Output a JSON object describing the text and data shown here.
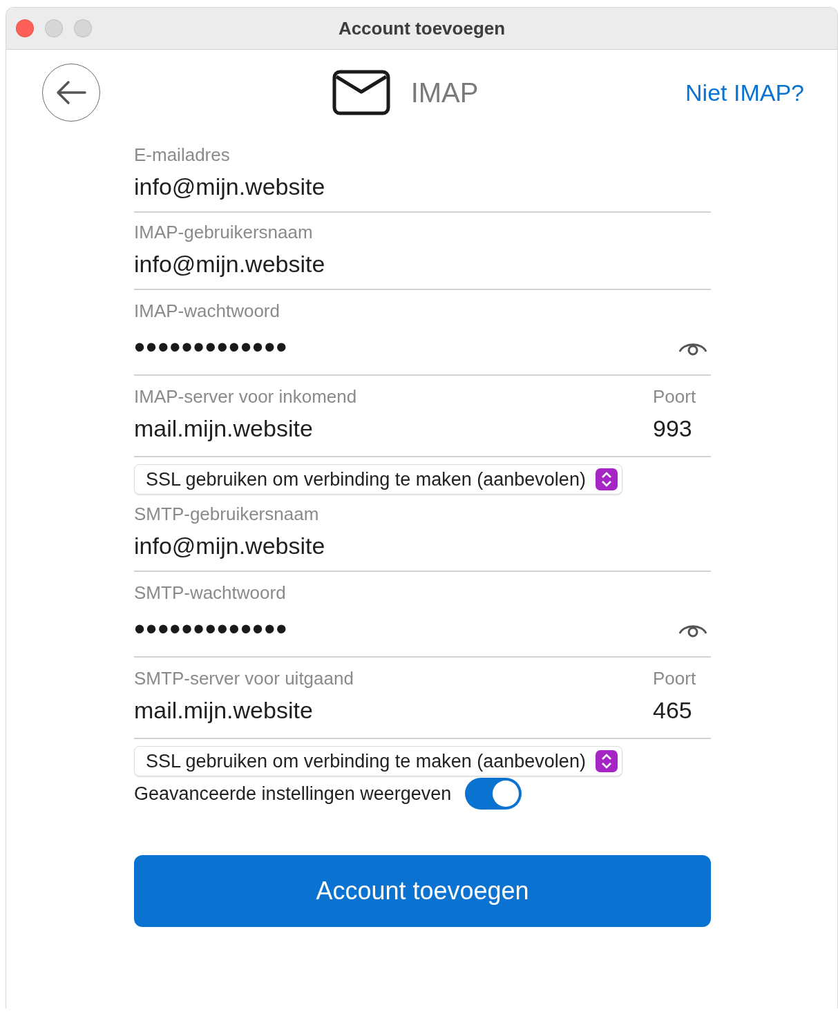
{
  "window": {
    "title": "Account toevoegen"
  },
  "header": {
    "protocol": "IMAP",
    "switch_link": "Niet IMAP?"
  },
  "fields": [
    {
      "kind": "text",
      "label": "E-mailadres",
      "value": "info@mijn.website"
    },
    {
      "kind": "text",
      "label": "IMAP-gebruikersnaam",
      "value": "info@mijn.website"
    },
    {
      "kind": "password",
      "label": "IMAP-wachtwoord",
      "value": "•••••••••••••"
    },
    {
      "kind": "server",
      "label": "IMAP-server voor inkomend",
      "value": "mail.mijn.website",
      "port_label": "Poort",
      "port": "993"
    },
    {
      "kind": "select",
      "value": "SSL gebruiken om verbinding te maken (aanbevolen)"
    },
    {
      "kind": "text",
      "label": "SMTP-gebruikersnaam",
      "value": "info@mijn.website"
    },
    {
      "kind": "password",
      "label": "SMTP-wachtwoord",
      "value": "•••••••••••••"
    },
    {
      "kind": "server",
      "label": "SMTP-server voor uitgaand",
      "value": "mail.mijn.website",
      "port_label": "Poort",
      "port": "465"
    },
    {
      "kind": "select",
      "value": "SSL gebruiken om verbinding te maken (aanbevolen)"
    },
    {
      "kind": "toggle",
      "label": "Geavanceerde instellingen weergeven",
      "on": true
    }
  ],
  "submit_button": "Account toevoegen"
}
